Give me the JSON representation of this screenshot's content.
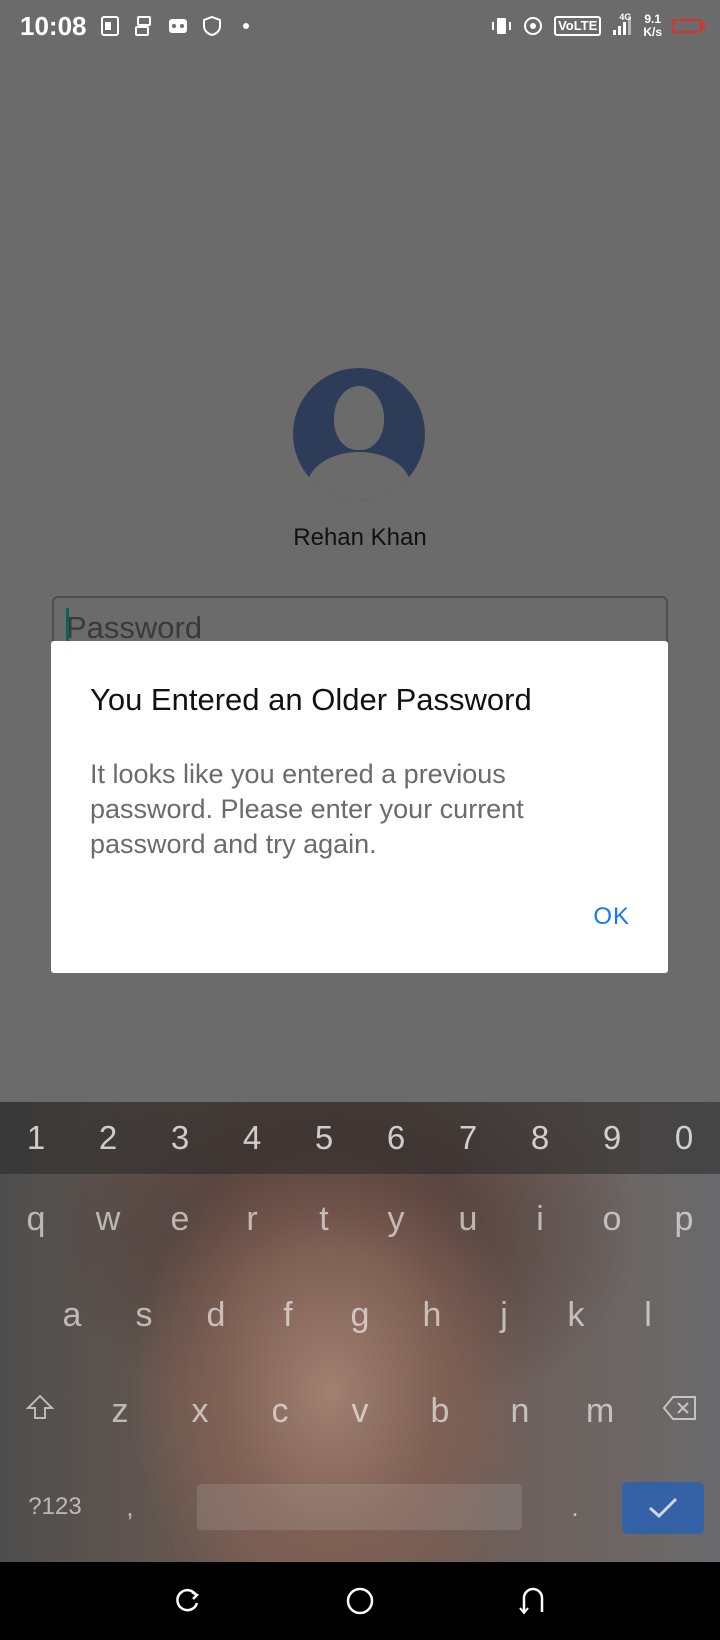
{
  "status_bar": {
    "time": "10:08",
    "network_type": "VoLTE",
    "signal_label": "4G",
    "net_speed_value": "9.1",
    "net_speed_unit": "K/s",
    "icons": [
      "pdf-icon",
      "sync-icon",
      "gamepad-icon",
      "shield-icon",
      "dot-icon",
      "vibrate-icon",
      "hotspot-icon",
      "volte-icon",
      "signal-icon",
      "battery-icon"
    ],
    "battery_color": "#e0302a"
  },
  "login": {
    "user_name": "Rehan Khan",
    "password_placeholder": "Password"
  },
  "dialog": {
    "title": "You Entered an Older Password",
    "message": "It looks like you entered a previous password. Please enter your current password and try again.",
    "ok_label": "OK",
    "ok_color": "#1877f2"
  },
  "keyboard": {
    "numbers": [
      "1",
      "2",
      "3",
      "4",
      "5",
      "6",
      "7",
      "8",
      "9",
      "0"
    ],
    "row1": [
      "q",
      "w",
      "e",
      "r",
      "t",
      "y",
      "u",
      "i",
      "o",
      "p"
    ],
    "row2": [
      "a",
      "s",
      "d",
      "f",
      "g",
      "h",
      "j",
      "k",
      "l"
    ],
    "row3": [
      "z",
      "x",
      "c",
      "v",
      "b",
      "n",
      "m"
    ],
    "symbols_label": "?123",
    "comma_label": ",",
    "period_label": ".",
    "enter_color": "#3561a6"
  },
  "nav_bar": {
    "buttons": [
      "recent-apps-icon",
      "home-icon",
      "back-icon"
    ]
  }
}
